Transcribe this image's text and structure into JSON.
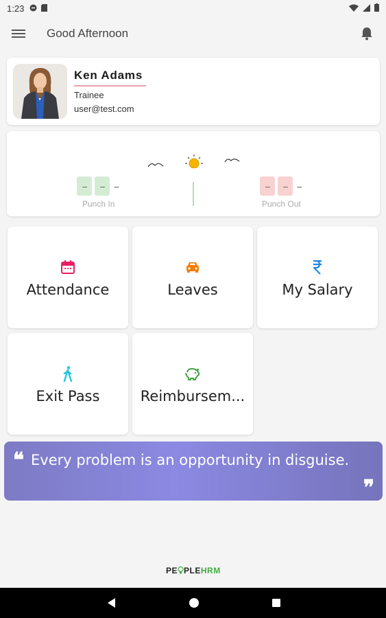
{
  "status_bar": {
    "time": "1:23"
  },
  "header": {
    "title": "Good Afternoon"
  },
  "profile": {
    "name": "Ken Adams",
    "role": "Trainee",
    "email": "user@test.com"
  },
  "attendance": {
    "punch_in": {
      "digit1": "--",
      "digit2": "--",
      "suffix": "--",
      "label": "Punch In"
    },
    "punch_out": {
      "digit1": "--",
      "digit2": "--",
      "suffix": "--",
      "label": "Punch Out"
    }
  },
  "tiles": [
    {
      "label": "Attendance",
      "icon": "calendar-icon",
      "color": "#e91e63"
    },
    {
      "label": "Leaves",
      "icon": "car-icon",
      "color": "#f57c00"
    },
    {
      "label": "My Salary",
      "icon": "rupee-icon",
      "color": "#1e88e5"
    },
    {
      "label": "Exit Pass",
      "icon": "walking-person-icon",
      "color": "#26c6da"
    },
    {
      "label": "Reimbursem...",
      "icon": "piggy-bank-icon",
      "color": "#43a047"
    }
  ],
  "quote": {
    "text": "Every problem is an opportunity in disguise."
  },
  "footer": {
    "brand_part1": "PE",
    "brand_part2": "PLE",
    "brand_part3": "HRM"
  },
  "colors": {
    "accent_quote": "#8b89e2",
    "punch_in_box": "#d5ecd4",
    "punch_out_box": "#f7d2d0",
    "brand_green": "#3fae3b"
  }
}
